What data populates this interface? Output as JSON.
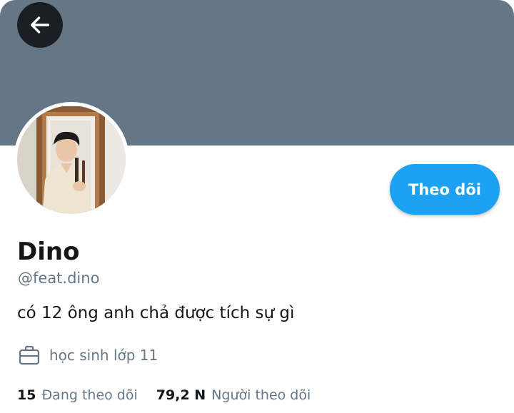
{
  "header": {
    "back_icon": "arrow-left-icon",
    "banner_color": "#657786"
  },
  "profile": {
    "avatar": "profile-photo",
    "display_name": "Dino",
    "handle": "@feat.dino",
    "bio": "có 12 ông anh chả được tích sự gì",
    "occupation_icon": "briefcase-icon",
    "occupation": "học sinh lớp 11"
  },
  "actions": {
    "follow_label": "Theo dõi",
    "accent_color": "#1da1f2"
  },
  "stats": {
    "following_count": "15",
    "following_label": "Đang theo dõi",
    "followers_count": "79,2 N",
    "followers_label": "Người theo dõi"
  }
}
